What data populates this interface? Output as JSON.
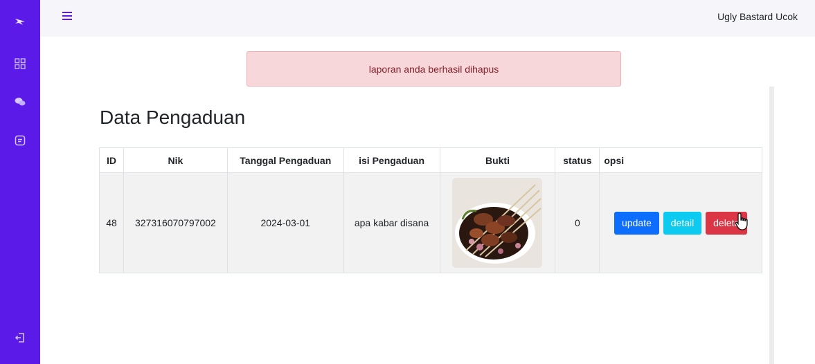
{
  "header": {
    "user_name": "Ugly Bastard Ucok"
  },
  "sidebar": {
    "items": [
      {
        "name": "logo",
        "icon": "bird-logo-icon"
      },
      {
        "name": "dashboard",
        "icon": "grid-icon"
      },
      {
        "name": "chat",
        "icon": "chat-icon"
      },
      {
        "name": "reports",
        "icon": "document-icon"
      },
      {
        "name": "logout",
        "icon": "logout-icon"
      }
    ]
  },
  "alert": {
    "message": "laporan anda berhasil dihapus"
  },
  "page": {
    "title": "Data Pengaduan"
  },
  "table": {
    "headers": [
      "ID",
      "Nik",
      "Tanggal Pengaduan",
      "isi Pengaduan",
      "Bukti",
      "status",
      "opsi"
    ],
    "rows": [
      {
        "id": "48",
        "nik": "327316070797002",
        "tanggal": "2024-03-01",
        "isi": "apa kabar disana",
        "status": "0"
      }
    ],
    "actions": {
      "update": "update",
      "detail": "detail",
      "delete": "delete"
    }
  },
  "colors": {
    "sidebar": "#5b1ae8",
    "alert_bg": "#f8d7da",
    "alert_text": "#842029",
    "btn_update": "#0d6efd",
    "btn_detail": "#0dcaf0",
    "btn_delete": "#dc3545"
  }
}
